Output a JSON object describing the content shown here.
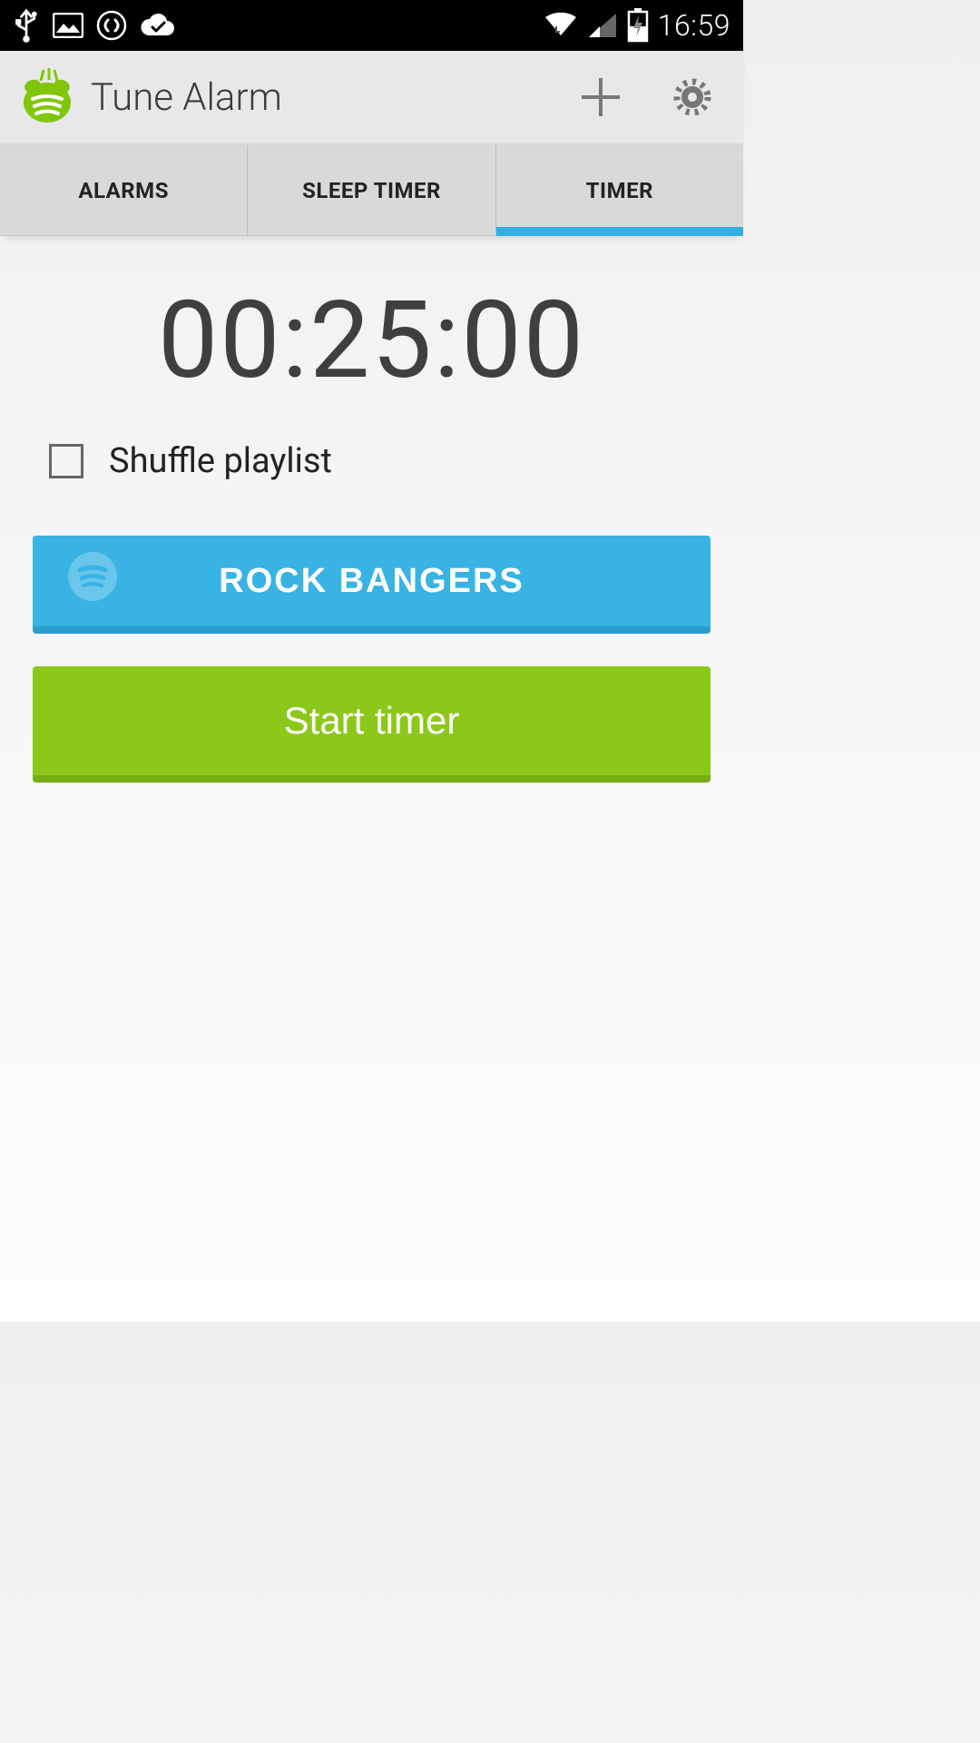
{
  "status_bar": {
    "time": "16:59",
    "icons_left": [
      "usb-icon",
      "image-icon",
      "shazam-icon",
      "cloud-check-icon"
    ],
    "icons_right": [
      "wifi-icon",
      "cell-signal-icon",
      "battery-charging-icon"
    ]
  },
  "app_bar": {
    "title": "Tune Alarm",
    "add_label": "+",
    "settings_label": "⚙"
  },
  "tabs": [
    {
      "label": "ALARMS",
      "active": false
    },
    {
      "label": "SLEEP TIMER",
      "active": false
    },
    {
      "label": "TIMER",
      "active": true
    }
  ],
  "timer": {
    "display": "00:25:00",
    "shuffle_label": "Shuffle playlist",
    "shuffle_checked": false,
    "playlist_name": "ROCK BANGERS",
    "start_label": "Start timer"
  },
  "colors": {
    "accent_blue": "#38b3e3",
    "accent_green": "#8bc819",
    "tab_underline": "#30b0e4"
  }
}
